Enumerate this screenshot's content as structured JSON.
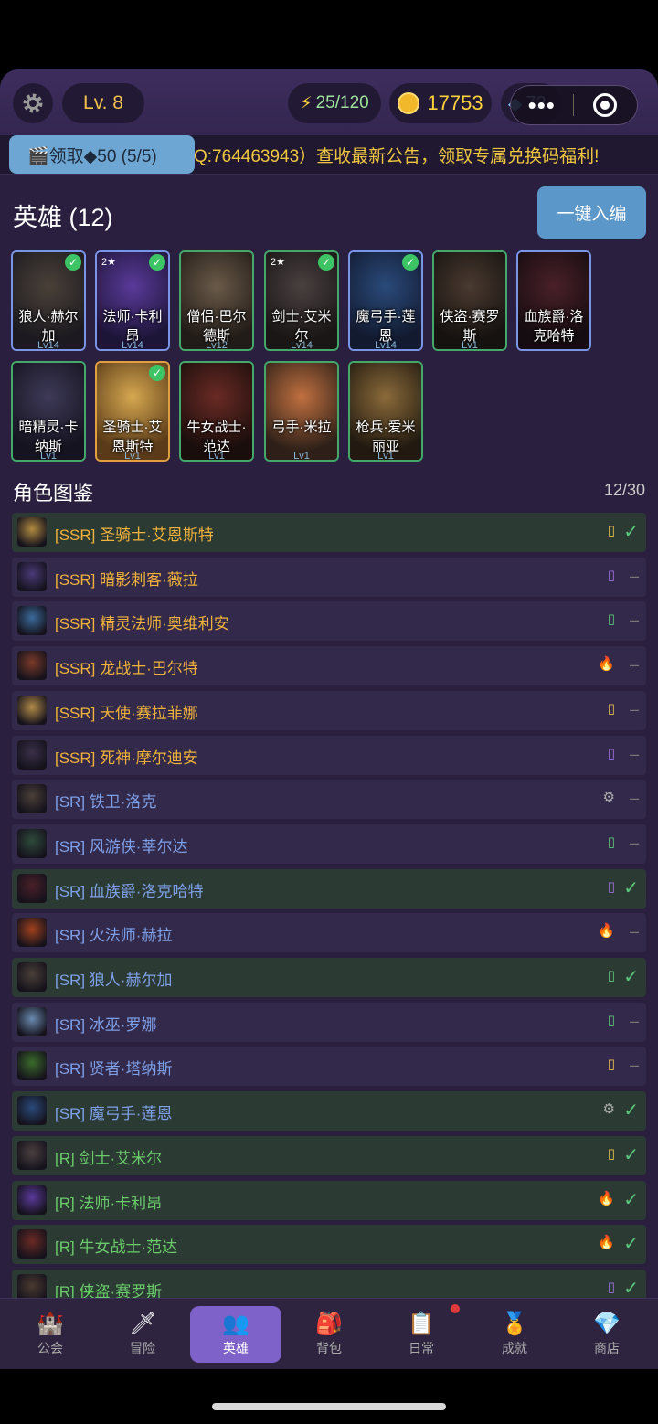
{
  "topbar": {
    "level": "Lv. 8",
    "energy": "25/120",
    "gold": "17753",
    "gems": "72",
    "capsule_dots": "•••"
  },
  "ticker": {
    "claim_label": "🎬领取◆50 (5/5)",
    "text": "Q:764463943）查收最新公告，领取专属兑换码福利!"
  },
  "heroes": {
    "title": "英雄 (12)",
    "auto_button": "一键入编",
    "cards": [
      {
        "name": "狼人·赫尔加",
        "lv": "Lv14",
        "checked": true,
        "stars": "",
        "frame": "blue",
        "c1": "#4a4038",
        "c2": "#1c1a20"
      },
      {
        "name": "法师·卡利昂",
        "lv": "Lv14",
        "checked": true,
        "stars": "2★",
        "frame": "blue",
        "c1": "#5a3a9a",
        "c2": "#1d1538"
      },
      {
        "name": "僧侣·巴尔德斯",
        "lv": "Lv12",
        "checked": false,
        "stars": "",
        "frame": "green",
        "c1": "#6a5a48",
        "c2": "#221c18"
      },
      {
        "name": "剑士·艾米尔",
        "lv": "Lv14",
        "checked": true,
        "stars": "2★",
        "frame": "green",
        "c1": "#4a4040",
        "c2": "#1a1616"
      },
      {
        "name": "魔弓手·莲恩",
        "lv": "Lv14",
        "checked": true,
        "stars": "",
        "frame": "blue",
        "c1": "#2a4a7a",
        "c2": "#121a30"
      },
      {
        "name": "侠盗·赛罗斯",
        "lv": "Lv1",
        "checked": false,
        "stars": "",
        "frame": "green",
        "c1": "#4a3a30",
        "c2": "#161210"
      },
      {
        "name": "血族爵·洛克哈特",
        "lv": "",
        "checked": false,
        "stars": "",
        "frame": "blue",
        "c1": "#4a2028",
        "c2": "#140c10"
      },
      {
        "name": "暗精灵·卡纳斯",
        "lv": "Lv1",
        "checked": false,
        "stars": "",
        "frame": "green",
        "c1": "#3e3a58",
        "c2": "#15131f"
      },
      {
        "name": "圣骑士·艾恩斯特",
        "lv": "Lv1",
        "checked": true,
        "stars": "",
        "frame": "gold",
        "c1": "#d6a850",
        "c2": "#5a3a18"
      },
      {
        "name": "牛女战士·范达",
        "lv": "Lv1",
        "checked": false,
        "stars": "",
        "frame": "green",
        "c1": "#6a2a24",
        "c2": "#1a0e0c"
      },
      {
        "name": "弓手·米拉",
        "lv": "Lv1",
        "checked": false,
        "stars": "",
        "frame": "green",
        "c1": "#c07040",
        "c2": "#2e2018"
      },
      {
        "name": "枪兵·爱米丽亚",
        "lv": "Lv1",
        "checked": false,
        "stars": "",
        "frame": "green",
        "c1": "#8a6a3a",
        "c2": "#221a10"
      }
    ]
  },
  "collection": {
    "title": "角色图鉴",
    "count": "12/30",
    "rows": [
      {
        "label": "[SSR] 圣骑士·艾恩斯特",
        "rarity": "ssr",
        "owned": true,
        "elem": "▯",
        "elem_color": "#e6c04a",
        "thumb": "#b08a40"
      },
      {
        "label": "[SSR] 暗影刺客·薇拉",
        "rarity": "ssr",
        "owned": false,
        "elem": "▯",
        "elem_color": "#a070e0",
        "thumb": "#4a3a78"
      },
      {
        "label": "[SSR] 精灵法师·奥维利安",
        "rarity": "ssr",
        "owned": false,
        "elem": "▯",
        "elem_color": "#5ac87a",
        "thumb": "#3a6a9a"
      },
      {
        "label": "[SSR] 龙战士·巴尔特",
        "rarity": "ssr",
        "owned": false,
        "elem": "🔥",
        "elem_color": "#ff7a2a",
        "thumb": "#7a3a28"
      },
      {
        "label": "[SSR] 天使·赛拉菲娜",
        "rarity": "ssr",
        "owned": false,
        "elem": "▯",
        "elem_color": "#e6c04a",
        "thumb": "#b08a48"
      },
      {
        "label": "[SSR] 死神·摩尔迪安",
        "rarity": "ssr",
        "owned": false,
        "elem": "▯",
        "elem_color": "#a070e0",
        "thumb": "#3a3048"
      },
      {
        "label": "[SR] 铁卫·洛克",
        "rarity": "sr",
        "owned": false,
        "elem": "⚙",
        "elem_color": "#aaaaaa",
        "thumb": "#4a4038"
      },
      {
        "label": "[SR] 风游侠·莘尔达",
        "rarity": "sr",
        "owned": false,
        "elem": "▯",
        "elem_color": "#5ac87a",
        "thumb": "#2e4a3a"
      },
      {
        "label": "[SR] 血族爵·洛克哈特",
        "rarity": "sr",
        "owned": true,
        "elem": "▯",
        "elem_color": "#a070e0",
        "thumb": "#4a2028"
      },
      {
        "label": "[SR] 火法师·赫拉",
        "rarity": "sr",
        "owned": false,
        "elem": "🔥",
        "elem_color": "#ff7a2a",
        "thumb": "#a0401c"
      },
      {
        "label": "[SR] 狼人·赫尔加",
        "rarity": "sr",
        "owned": true,
        "elem": "▯",
        "elem_color": "#5ac87a",
        "thumb": "#4a4038"
      },
      {
        "label": "[SR] 冰巫·罗娜",
        "rarity": "sr",
        "owned": false,
        "elem": "▯",
        "elem_color": "#5ac87a",
        "thumb": "#6a8ab0"
      },
      {
        "label": "[SR] 贤者·塔纳斯",
        "rarity": "sr",
        "owned": false,
        "elem": "▯",
        "elem_color": "#e6c04a",
        "thumb": "#3a6a2a"
      },
      {
        "label": "[SR] 魔弓手·莲恩",
        "rarity": "sr",
        "owned": true,
        "elem": "⚙",
        "elem_color": "#aaaaaa",
        "thumb": "#2a4a7a"
      },
      {
        "label": "[R] 剑士·艾米尔",
        "rarity": "r",
        "owned": true,
        "elem": "▯",
        "elem_color": "#e6c04a",
        "thumb": "#4a4040"
      },
      {
        "label": "[R] 法师·卡利昂",
        "rarity": "r",
        "owned": true,
        "elem": "🔥",
        "elem_color": "#ff7a2a",
        "thumb": "#5a3a9a"
      },
      {
        "label": "[R] 牛女战士·范达",
        "rarity": "r",
        "owned": true,
        "elem": "🔥",
        "elem_color": "#ff7a2a",
        "thumb": "#6a2a24"
      },
      {
        "label": "[R] 侠盗·赛罗斯",
        "rarity": "r",
        "owned": true,
        "elem": "▯",
        "elem_color": "#a070e0",
        "thumb": "#4a3a30"
      }
    ]
  },
  "nav": [
    {
      "label": "公会",
      "icon": "castle-icon",
      "glyph": "🏰",
      "active": false
    },
    {
      "label": "冒险",
      "icon": "sword-icon",
      "glyph": "🗡",
      "active": false
    },
    {
      "label": "英雄",
      "icon": "hero-icon",
      "glyph": "👥",
      "active": true
    },
    {
      "label": "背包",
      "icon": "backpack-icon",
      "glyph": "🎒",
      "active": false
    },
    {
      "label": "日常",
      "icon": "clipboard-icon",
      "glyph": "📋",
      "active": false
    },
    {
      "label": "成就",
      "icon": "medal-icon",
      "glyph": "🏅",
      "active": false
    },
    {
      "label": "商店",
      "icon": "diamond-icon",
      "glyph": "💎",
      "active": false
    }
  ]
}
